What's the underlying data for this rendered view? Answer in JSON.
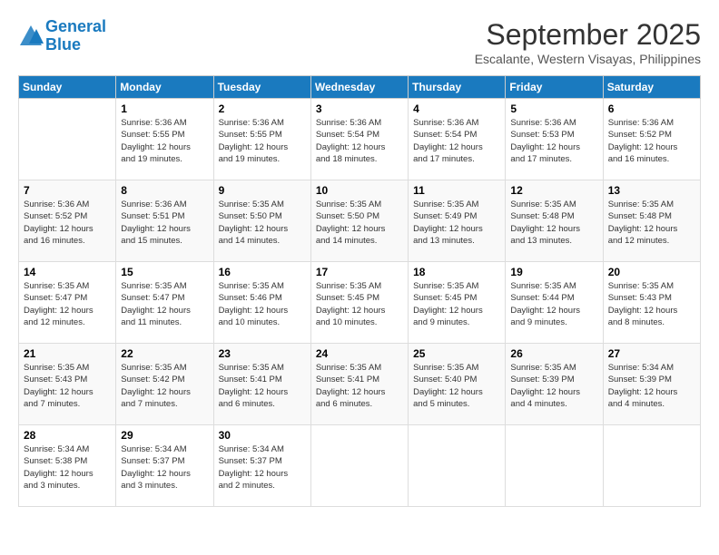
{
  "header": {
    "logo_line1": "General",
    "logo_line2": "Blue",
    "title": "September 2025",
    "location": "Escalante, Western Visayas, Philippines"
  },
  "days_of_week": [
    "Sunday",
    "Monday",
    "Tuesday",
    "Wednesday",
    "Thursday",
    "Friday",
    "Saturday"
  ],
  "weeks": [
    [
      {
        "num": "",
        "info": ""
      },
      {
        "num": "1",
        "info": "Sunrise: 5:36 AM\nSunset: 5:55 PM\nDaylight: 12 hours\nand 19 minutes."
      },
      {
        "num": "2",
        "info": "Sunrise: 5:36 AM\nSunset: 5:55 PM\nDaylight: 12 hours\nand 19 minutes."
      },
      {
        "num": "3",
        "info": "Sunrise: 5:36 AM\nSunset: 5:54 PM\nDaylight: 12 hours\nand 18 minutes."
      },
      {
        "num": "4",
        "info": "Sunrise: 5:36 AM\nSunset: 5:54 PM\nDaylight: 12 hours\nand 17 minutes."
      },
      {
        "num": "5",
        "info": "Sunrise: 5:36 AM\nSunset: 5:53 PM\nDaylight: 12 hours\nand 17 minutes."
      },
      {
        "num": "6",
        "info": "Sunrise: 5:36 AM\nSunset: 5:52 PM\nDaylight: 12 hours\nand 16 minutes."
      }
    ],
    [
      {
        "num": "7",
        "info": "Sunrise: 5:36 AM\nSunset: 5:52 PM\nDaylight: 12 hours\nand 16 minutes."
      },
      {
        "num": "8",
        "info": "Sunrise: 5:36 AM\nSunset: 5:51 PM\nDaylight: 12 hours\nand 15 minutes."
      },
      {
        "num": "9",
        "info": "Sunrise: 5:35 AM\nSunset: 5:50 PM\nDaylight: 12 hours\nand 14 minutes."
      },
      {
        "num": "10",
        "info": "Sunrise: 5:35 AM\nSunset: 5:50 PM\nDaylight: 12 hours\nand 14 minutes."
      },
      {
        "num": "11",
        "info": "Sunrise: 5:35 AM\nSunset: 5:49 PM\nDaylight: 12 hours\nand 13 minutes."
      },
      {
        "num": "12",
        "info": "Sunrise: 5:35 AM\nSunset: 5:48 PM\nDaylight: 12 hours\nand 13 minutes."
      },
      {
        "num": "13",
        "info": "Sunrise: 5:35 AM\nSunset: 5:48 PM\nDaylight: 12 hours\nand 12 minutes."
      }
    ],
    [
      {
        "num": "14",
        "info": "Sunrise: 5:35 AM\nSunset: 5:47 PM\nDaylight: 12 hours\nand 12 minutes."
      },
      {
        "num": "15",
        "info": "Sunrise: 5:35 AM\nSunset: 5:47 PM\nDaylight: 12 hours\nand 11 minutes."
      },
      {
        "num": "16",
        "info": "Sunrise: 5:35 AM\nSunset: 5:46 PM\nDaylight: 12 hours\nand 10 minutes."
      },
      {
        "num": "17",
        "info": "Sunrise: 5:35 AM\nSunset: 5:45 PM\nDaylight: 12 hours\nand 10 minutes."
      },
      {
        "num": "18",
        "info": "Sunrise: 5:35 AM\nSunset: 5:45 PM\nDaylight: 12 hours\nand 9 minutes."
      },
      {
        "num": "19",
        "info": "Sunrise: 5:35 AM\nSunset: 5:44 PM\nDaylight: 12 hours\nand 9 minutes."
      },
      {
        "num": "20",
        "info": "Sunrise: 5:35 AM\nSunset: 5:43 PM\nDaylight: 12 hours\nand 8 minutes."
      }
    ],
    [
      {
        "num": "21",
        "info": "Sunrise: 5:35 AM\nSunset: 5:43 PM\nDaylight: 12 hours\nand 7 minutes."
      },
      {
        "num": "22",
        "info": "Sunrise: 5:35 AM\nSunset: 5:42 PM\nDaylight: 12 hours\nand 7 minutes."
      },
      {
        "num": "23",
        "info": "Sunrise: 5:35 AM\nSunset: 5:41 PM\nDaylight: 12 hours\nand 6 minutes."
      },
      {
        "num": "24",
        "info": "Sunrise: 5:35 AM\nSunset: 5:41 PM\nDaylight: 12 hours\nand 6 minutes."
      },
      {
        "num": "25",
        "info": "Sunrise: 5:35 AM\nSunset: 5:40 PM\nDaylight: 12 hours\nand 5 minutes."
      },
      {
        "num": "26",
        "info": "Sunrise: 5:35 AM\nSunset: 5:39 PM\nDaylight: 12 hours\nand 4 minutes."
      },
      {
        "num": "27",
        "info": "Sunrise: 5:34 AM\nSunset: 5:39 PM\nDaylight: 12 hours\nand 4 minutes."
      }
    ],
    [
      {
        "num": "28",
        "info": "Sunrise: 5:34 AM\nSunset: 5:38 PM\nDaylight: 12 hours\nand 3 minutes."
      },
      {
        "num": "29",
        "info": "Sunrise: 5:34 AM\nSunset: 5:37 PM\nDaylight: 12 hours\nand 3 minutes."
      },
      {
        "num": "30",
        "info": "Sunrise: 5:34 AM\nSunset: 5:37 PM\nDaylight: 12 hours\nand 2 minutes."
      },
      {
        "num": "",
        "info": ""
      },
      {
        "num": "",
        "info": ""
      },
      {
        "num": "",
        "info": ""
      },
      {
        "num": "",
        "info": ""
      }
    ]
  ]
}
